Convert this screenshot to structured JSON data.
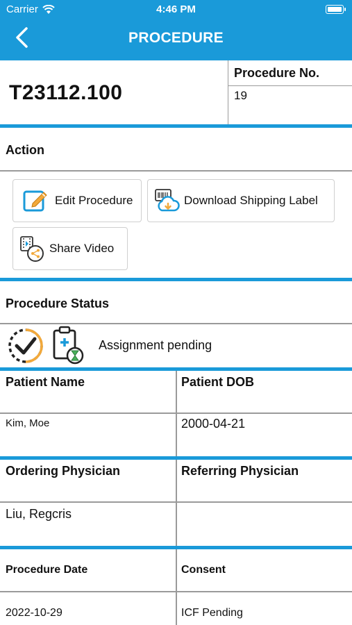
{
  "status_bar": {
    "carrier": "Carrier",
    "time": "4:46 PM"
  },
  "nav": {
    "title": "PROCEDURE",
    "back_icon": "chevron-left-icon"
  },
  "procedure": {
    "id": "T23112.100",
    "number_label": "Procedure No.",
    "number_value": "19"
  },
  "action": {
    "title": "Action",
    "buttons": [
      {
        "label": "Edit Procedure",
        "icon": "edit-icon"
      },
      {
        "label": "Download Shipping Label",
        "icon": "download-label-icon"
      },
      {
        "label": "Share Video",
        "icon": "share-video-icon"
      }
    ]
  },
  "procedure_status": {
    "title": "Procedure Status",
    "text": "Assignment pending"
  },
  "patient": {
    "name_label": "Patient Name",
    "name_value": "Kim, Moe",
    "dob_label": "Patient DOB",
    "dob_value": "2000-04-21"
  },
  "physicians": {
    "ordering_label": "Ordering Physician",
    "ordering_value": "Liu, Regcris",
    "referring_label": "Referring Physician",
    "referring_value": ""
  },
  "dates": {
    "date_label": "Procedure Date",
    "date_value": "2022-10-29",
    "consent_label": "Consent",
    "consent_value": "ICF Pending"
  },
  "colors": {
    "accent": "#1a9ad9",
    "icon_orange": "#f2a93b",
    "icon_green": "#49b05a"
  }
}
